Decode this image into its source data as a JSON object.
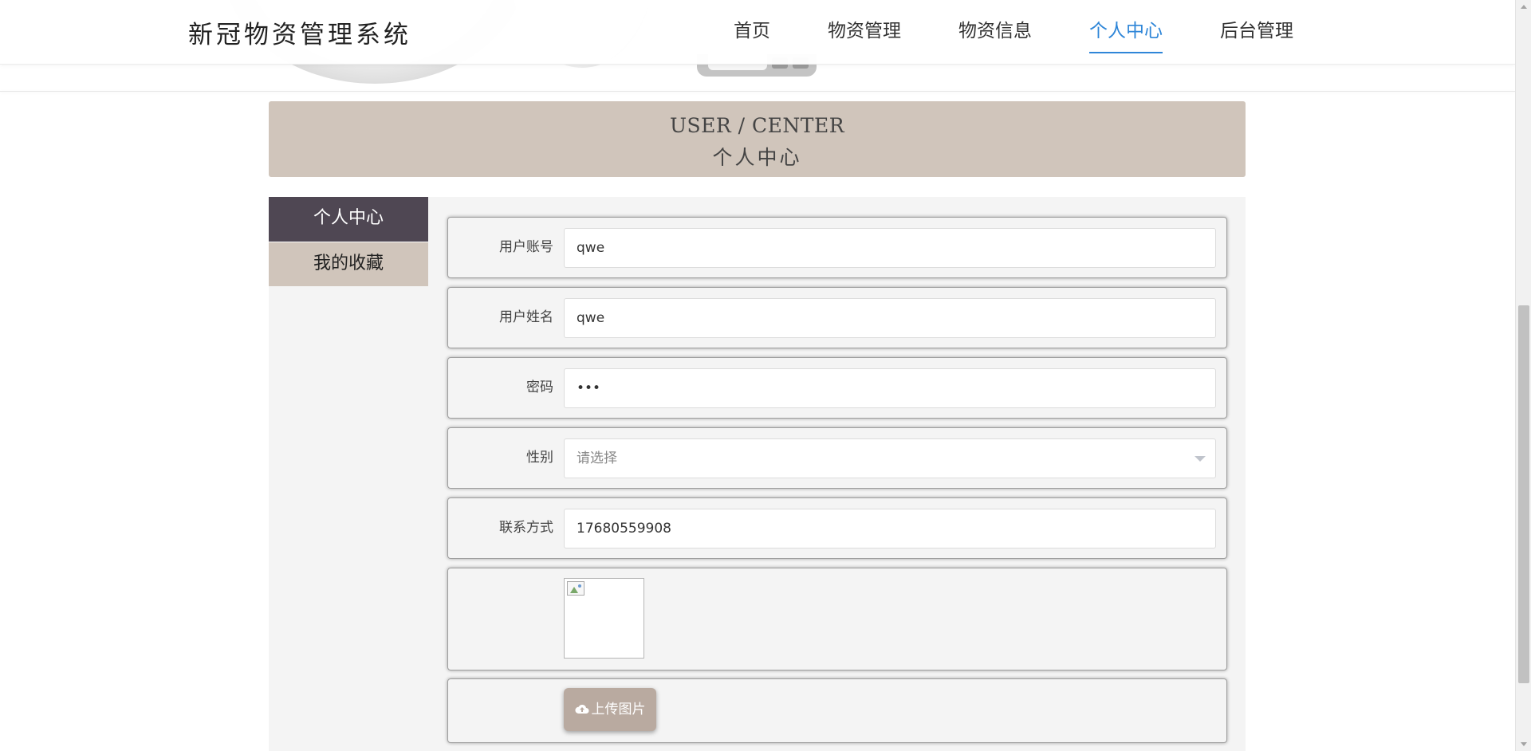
{
  "header": {
    "logo": "新冠物资管理系统",
    "nav": [
      {
        "label": "首页",
        "active": false
      },
      {
        "label": "物资管理",
        "active": false
      },
      {
        "label": "物资信息",
        "active": false
      },
      {
        "label": "个人中心",
        "active": true
      },
      {
        "label": "后台管理",
        "active": false
      }
    ],
    "active_color": "#2f86d8"
  },
  "page_title": {
    "en": "USER / CENTER",
    "cn": "个人中心",
    "background": "#d0c5bb"
  },
  "side_menu": {
    "items": [
      {
        "label": "个人中心",
        "active": true
      },
      {
        "label": "我的收藏",
        "active": false
      }
    ],
    "active_bg": "#4f4753",
    "normal_bg": "#d0c5bb"
  },
  "form": {
    "account": {
      "label": "用户账号",
      "value": "qwe"
    },
    "name": {
      "label": "用户姓名",
      "value": "qwe"
    },
    "password": {
      "label": "密码",
      "value": "•••"
    },
    "gender": {
      "label": "性别",
      "placeholder": "请选择"
    },
    "contact": {
      "label": "联系方式",
      "value": "17680559908"
    },
    "photo": {
      "icon": "broken-image-icon"
    },
    "upload": {
      "label": "上传图片",
      "icon": "cloud-upload-icon",
      "color": "#b9aaa0"
    }
  }
}
